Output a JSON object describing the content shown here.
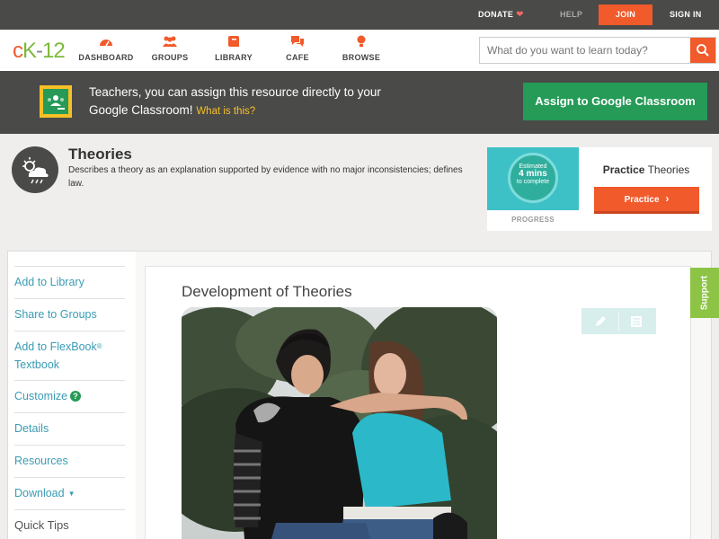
{
  "topbar": {
    "donate": "DONATE",
    "help": "HELP",
    "join": "JOIN",
    "signin": "SIGN IN"
  },
  "nav": {
    "items": [
      {
        "label": "DASHBOARD",
        "icon": "dashboard-icon"
      },
      {
        "label": "GROUPS",
        "icon": "groups-icon"
      },
      {
        "label": "LIBRARY",
        "icon": "library-icon"
      },
      {
        "label": "CAFE",
        "icon": "cafe-icon"
      },
      {
        "label": "BROWSE",
        "icon": "browse-icon"
      }
    ],
    "search_placeholder": "What do you want to learn today?"
  },
  "banner": {
    "text": "Teachers, you can assign this resource directly to your Google Classroom!",
    "what_link": "What is this?",
    "button": "Assign to Google Classroom"
  },
  "concept": {
    "title": "Theories",
    "description": "Describes a theory as an explanation supported by evidence with no major inconsistencies; defines law."
  },
  "practice": {
    "estimated": "Estimated",
    "mins": "4 mins",
    "to_complete": "to complete",
    "progress_label": "PROGRESS",
    "title_bold": "Practice",
    "title_rest": "Theories",
    "button": "Practice"
  },
  "sidebar": {
    "items": [
      {
        "label": "Add to Library"
      },
      {
        "label": "Share to Groups"
      },
      {
        "label": "Add to FlexBook",
        "sup": "®",
        "label2": "Textbook"
      },
      {
        "label": "Customize",
        "help": "?"
      },
      {
        "label": "Details"
      },
      {
        "label": "Resources"
      },
      {
        "label": "Download"
      },
      {
        "label": "Quick Tips"
      }
    ]
  },
  "lesson": {
    "title": "Development of Theories"
  },
  "support": "Support",
  "colors": {
    "orange": "#f15a2b",
    "green": "#259b57",
    "dark": "#4a4a48",
    "link": "#3a9cb3"
  }
}
